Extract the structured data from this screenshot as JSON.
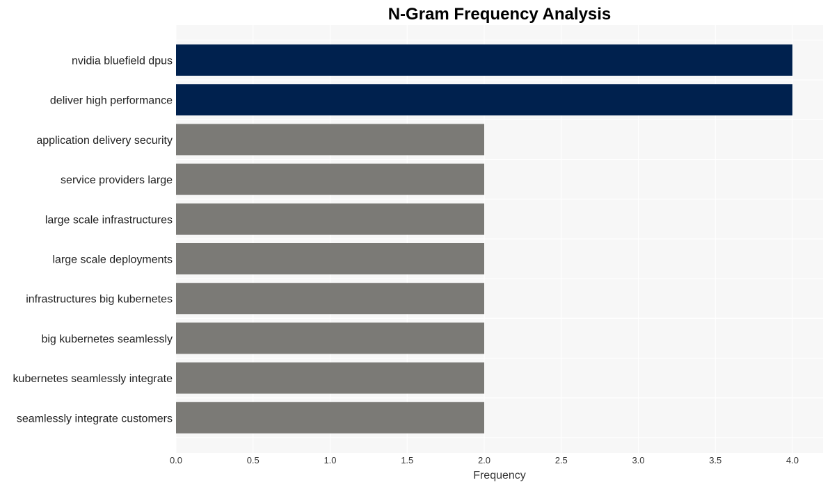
{
  "chart_data": {
    "type": "bar",
    "orientation": "horizontal",
    "title": "N-Gram Frequency Analysis",
    "xlabel": "Frequency",
    "ylabel": "",
    "xlim": [
      0,
      4.2
    ],
    "xticks": [
      "0.0",
      "0.5",
      "1.0",
      "1.5",
      "2.0",
      "2.5",
      "3.0",
      "3.5",
      "4.0"
    ],
    "grid": true,
    "categories": [
      "nvidia bluefield dpus",
      "deliver high performance",
      "application delivery security",
      "service providers large",
      "large scale infrastructures",
      "large scale deployments",
      "infrastructures big kubernetes",
      "big kubernetes seamlessly",
      "kubernetes seamlessly integrate",
      "seamlessly integrate customers"
    ],
    "values": [
      4,
      4,
      2,
      2,
      2,
      2,
      2,
      2,
      2,
      2
    ],
    "colors": {
      "highlight": "#00214e",
      "default": "#7b7a76",
      "plot_background": "#f7f7f7",
      "grid": "#ffffff"
    }
  }
}
